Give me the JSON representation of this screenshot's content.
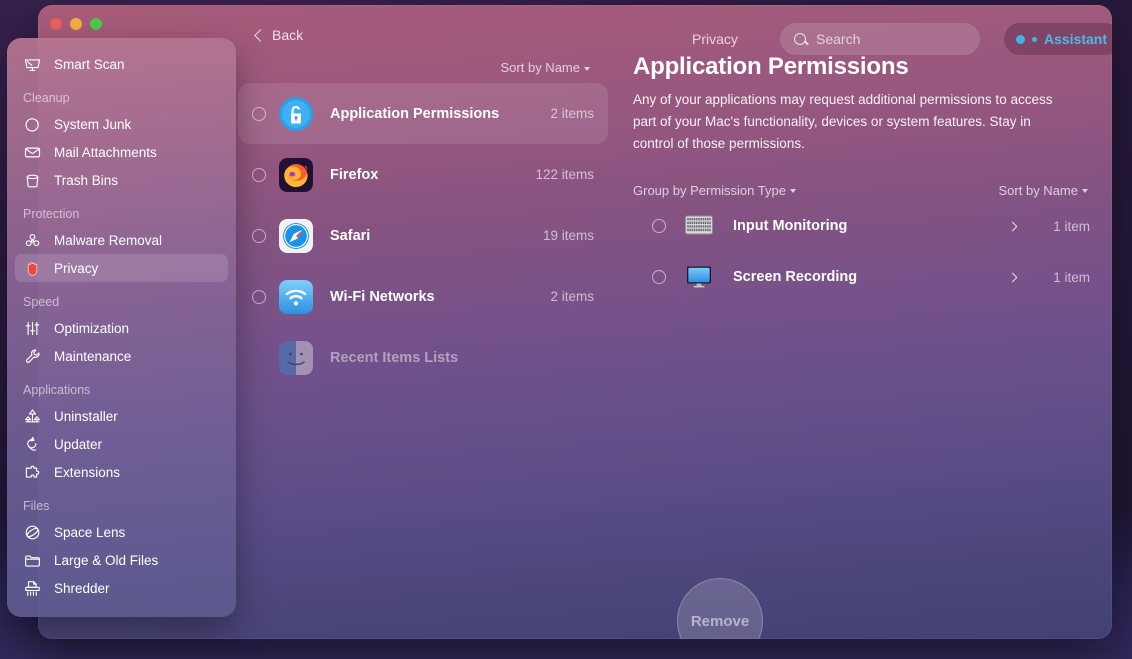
{
  "window": {
    "traffic_lights": [
      "close",
      "minimize",
      "zoom"
    ],
    "back_label": "Back",
    "breadcrumb": "Privacy",
    "search_placeholder": "Search",
    "search_value": "",
    "assistant_label": "Assistant",
    "accent_blue": "#4fb9ea",
    "bg_top": "#a85b78",
    "bg_mid": "#66508a",
    "bg_bottom": "#424073"
  },
  "sidebar": {
    "top_item": {
      "label": "Smart Scan",
      "icon": "smart-scan-icon"
    },
    "groups": [
      {
        "title": "Cleanup",
        "items": [
          {
            "label": "System Junk",
            "icon": "system-junk-icon",
            "active": false
          },
          {
            "label": "Mail Attachments",
            "icon": "mail-icon",
            "active": false
          },
          {
            "label": "Trash Bins",
            "icon": "trash-icon",
            "active": false
          }
        ]
      },
      {
        "title": "Protection",
        "items": [
          {
            "label": "Malware Removal",
            "icon": "biohazard-icon",
            "active": false
          },
          {
            "label": "Privacy",
            "icon": "hand-icon",
            "active": true
          }
        ]
      },
      {
        "title": "Speed",
        "items": [
          {
            "label": "Optimization",
            "icon": "sliders-icon",
            "active": false
          },
          {
            "label": "Maintenance",
            "icon": "wrench-icon",
            "active": false
          }
        ]
      },
      {
        "title": "Applications",
        "items": [
          {
            "label": "Uninstaller",
            "icon": "uninstaller-icon",
            "active": false
          },
          {
            "label": "Updater",
            "icon": "updater-icon",
            "active": false
          },
          {
            "label": "Extensions",
            "icon": "puzzle-icon",
            "active": false
          }
        ]
      },
      {
        "title": "Files",
        "items": [
          {
            "label": "Space Lens",
            "icon": "space-lens-icon",
            "active": false
          },
          {
            "label": "Large & Old Files",
            "icon": "folder-icon",
            "active": false
          },
          {
            "label": "Shredder",
            "icon": "shredder-icon",
            "active": false
          }
        ]
      }
    ]
  },
  "list_panel": {
    "sort_label": "Sort by Name",
    "rows": [
      {
        "name": "Application Permissions",
        "count": "2 items",
        "icon": "unlock-badge-icon",
        "selected": true,
        "has_radio": true,
        "dim": false
      },
      {
        "name": "Firefox",
        "count": "122 items",
        "icon": "firefox-icon",
        "selected": false,
        "has_radio": true,
        "dim": false
      },
      {
        "name": "Safari",
        "count": "19 items",
        "icon": "safari-icon",
        "selected": false,
        "has_radio": true,
        "dim": false
      },
      {
        "name": "Wi-Fi Networks",
        "count": "2 items",
        "icon": "wifi-icon",
        "selected": false,
        "has_radio": true,
        "dim": false
      },
      {
        "name": "Recent Items Lists",
        "count": "",
        "icon": "finder-icon",
        "selected": false,
        "has_radio": false,
        "dim": true
      }
    ]
  },
  "detail": {
    "title": "Application Permissions",
    "description": "Any of your applications may request additional permissions to access part of your Mac's functionality, devices or system features. Stay in control of those permissions.",
    "group_label": "Group by Permission Type",
    "sort_label": "Sort by Name",
    "rows": [
      {
        "name": "Input Monitoring",
        "count": "1 item",
        "icon": "keyboard-icon"
      },
      {
        "name": "Screen Recording",
        "count": "1 item",
        "icon": "display-icon"
      }
    ]
  },
  "footer": {
    "remove_label": "Remove",
    "remove_enabled": false
  }
}
